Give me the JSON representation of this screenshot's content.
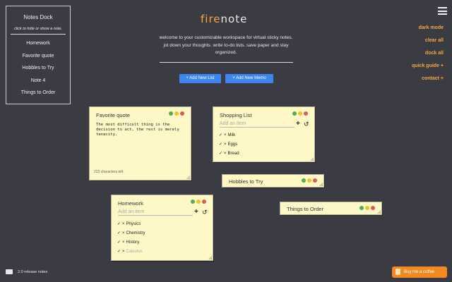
{
  "dock": {
    "title": "Notes Dock",
    "subtitle": "click to hide or show a note.",
    "items": [
      "Homework",
      "Favorite quote",
      "Hobbles to Try",
      "Note 4",
      "Things to Order"
    ]
  },
  "header": {
    "brand_fire": "fire",
    "brand_note": "note",
    "intro": "welcome to your customizable workspace for virtual sticky notes. jot down your thoughts. write to-do lists. save paper and stay organized.",
    "add_list_label": "+ Add New List",
    "add_memo_label": "+ Add New Memo"
  },
  "menu": {
    "dark_mode": "dark mode",
    "clear_all": "clear all",
    "dock_all": "dock all",
    "quick_guide": "quick guide +",
    "contact": "contact +"
  },
  "notes": {
    "quote": {
      "title": "Favorite quote",
      "body": "The most difficult thing is the decision to act, the rest is merely tenacity.",
      "count": "223 characters left"
    },
    "shopping": {
      "title": "Shopping List",
      "placeholder": "Add an item",
      "items": [
        "Milk",
        "Eggs",
        "Bread"
      ]
    },
    "hobbies": {
      "title": "Hobbles to Try"
    },
    "homework": {
      "title": "Homework",
      "placeholder": "Add an item",
      "items": [
        "Physics",
        "Chemistry",
        "History",
        "Calculus"
      ]
    },
    "order": {
      "title": "Things to Order"
    }
  },
  "icons": {
    "check": "✓",
    "delete": "×",
    "add": "+",
    "undo": "↺"
  },
  "footer": {
    "release": "2.0 release notes",
    "coffee": "Buy me a coffee"
  },
  "colors": {
    "background": "#3b3b43",
    "accent": "#f4a93a",
    "button": "#3d86f0",
    "note": "#fdf8c6"
  }
}
